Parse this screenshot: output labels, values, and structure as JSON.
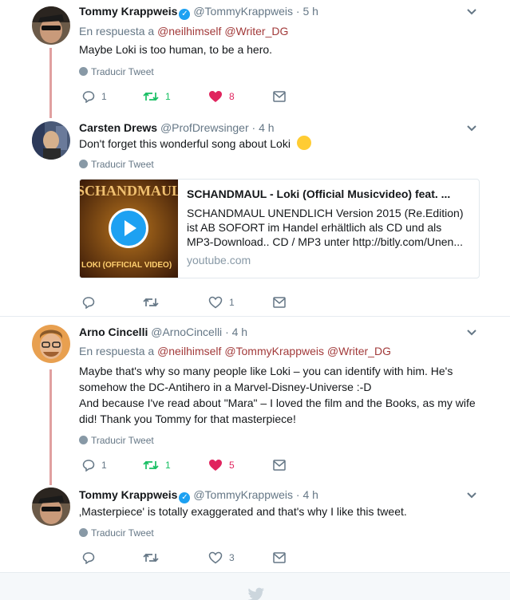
{
  "tweets": [
    {
      "name": "Tommy Krappweis",
      "verified": true,
      "handle": "@TommyKrappweis",
      "dot": "·",
      "time": "5 h",
      "reply_prefix": "En respuesta a",
      "mentions": [
        "@neilhimself",
        "@Writer_DG"
      ],
      "text": "Maybe Loki is too human, to be a  hero.",
      "translate": "Traducir Tweet",
      "actions": {
        "replies": "1",
        "retweets": "1",
        "likes": "8"
      }
    },
    {
      "name": "Carsten Drews",
      "handle": "@ProfDrewsinger",
      "dot": "·",
      "time": "4 h",
      "text": "Don't forget this wonderful song about Loki",
      "emoji": "😀",
      "translate": "Traducir Tweet",
      "card": {
        "title": "SCHANDMAUL - Loki (Official Musicvideo) feat. ...",
        "description": "SCHANDMAUL UNENDLICH Version 2015 (Re.Edition) ist AB SOFORT im Handel erhältlich als CD und als MP3-Download.. CD / MP3 unter http://bitly.com/Unen...",
        "domain": "youtube.com",
        "thumb_top_text": "SCHANDMAUL",
        "thumb_bottom_text": "LOKI (OFFICIAL VIDEO)"
      },
      "actions": {
        "likes": "1"
      }
    },
    {
      "name": "Arno Cincelli",
      "handle": "@ArnoCincelli",
      "dot": "·",
      "time": "4 h",
      "reply_prefix": "En respuesta a",
      "mentions": [
        "@neilhimself",
        "@TommyKrappweis",
        "@Writer_DG"
      ],
      "text_lines": [
        "Maybe that's why so many people like Loki – you can identify with him. He's",
        "somehow the DC-Antihero in a Marvel-Disney-Universe :-D",
        "And because I've read about \"Mara\" – I loved the film and the Books, as my wife",
        "did! Thank you Tommy for that masterpiece!"
      ],
      "translate": "Traducir Tweet",
      "actions": {
        "replies": "1",
        "retweets": "1",
        "likes": "5"
      }
    },
    {
      "name": "Tommy Krappweis",
      "verified": true,
      "handle": "@TommyKrappweis",
      "dot": "·",
      "time": "4 h",
      "text": "‚Masterpiece' is totally exaggerated and that's why I like this tweet.",
      "translate": "Traducir Tweet",
      "actions": {
        "likes": "3"
      }
    }
  ],
  "colors": {
    "accent_blue": "#1da1f2",
    "like_red": "#e0245e",
    "retweet_green": "#17bf63",
    "mention_red": "#a23a3a",
    "muted_gray": "#657786"
  }
}
